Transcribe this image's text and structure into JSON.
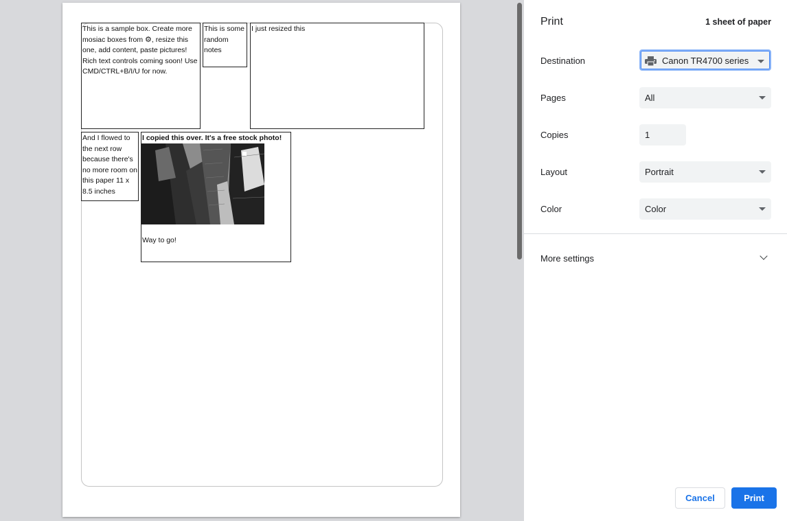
{
  "preview": {
    "box1_text": "This is a sample box. Create more mosiac boxes from",
    "box1_text2": ", resize this one, add content, paste pictures! Rich text controls coming soon! Use CMD/CTRL+B/I/U for now.",
    "box2_text": " This is some random notes",
    "box3_text": " I just resized this",
    "box4_text": " And I flowed to the next row because there's no more room on this paper 11 x 8.5 inches",
    "box5_heading": "I copied this over. It's a free stock photo!",
    "box5_footer": "Way to go!",
    "gear_icon": "gear-icon"
  },
  "panel": {
    "title": "Print",
    "sheet_count": "1 sheet of paper",
    "destination_label": "Destination",
    "destination_value": "Canon TR4700 series",
    "pages_label": "Pages",
    "pages_value": "All",
    "copies_label": "Copies",
    "copies_value": "1",
    "layout_label": "Layout",
    "layout_value": "Portrait",
    "color_label": "Color",
    "color_value": "Color",
    "more_settings": "More settings",
    "cancel": "Cancel",
    "print": "Print"
  },
  "colors": {
    "accent": "#1a73e8",
    "panel_bg": "#ffffff",
    "preview_bg": "#d8d9dc",
    "select_bg": "#f1f3f4"
  }
}
